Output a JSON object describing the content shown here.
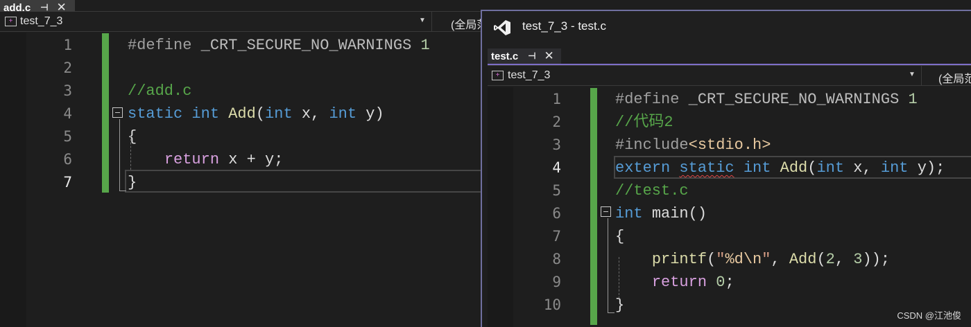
{
  "left_window": {
    "tab": {
      "label": "add.c",
      "pin_icon": "pin-icon",
      "close_icon": "close-icon"
    },
    "navbar": {
      "project": "test_7_3",
      "scope": "(全局范"
    },
    "lines": [
      {
        "num": "1",
        "tokens": [
          [
            "pp",
            "#define "
          ],
          [
            "macro",
            "_CRT_SECURE_NO_WARNINGS "
          ],
          [
            "num",
            "1"
          ]
        ]
      },
      {
        "num": "2",
        "tokens": []
      },
      {
        "num": "3",
        "tokens": [
          [
            "comment",
            "//add.c"
          ]
        ]
      },
      {
        "num": "4",
        "tokens": [
          [
            "kw",
            "static "
          ],
          [
            "kw",
            "int "
          ],
          [
            "fn",
            "Add"
          ],
          [
            "plain",
            "("
          ],
          [
            "kw",
            "int "
          ],
          [
            "plain",
            "x, "
          ],
          [
            "kw",
            "int "
          ],
          [
            "plain",
            "y)"
          ]
        ]
      },
      {
        "num": "5",
        "tokens": [
          [
            "plain",
            "{"
          ]
        ]
      },
      {
        "num": "6",
        "tokens": [
          [
            "plain",
            "    "
          ],
          [
            "ctrl",
            "return "
          ],
          [
            "plain",
            "x + y;"
          ]
        ]
      },
      {
        "num": "7",
        "tokens": [
          [
            "plain",
            "}"
          ]
        ]
      }
    ],
    "active_line": "7"
  },
  "right_window": {
    "title": "test_7_3 - test.c",
    "tab": {
      "label": "test.c",
      "pin_icon": "pin-icon",
      "close_icon": "close-icon"
    },
    "navbar": {
      "project": "test_7_3",
      "scope": "(全局范"
    },
    "lines": [
      {
        "num": "1",
        "tokens": [
          [
            "pp",
            "#define "
          ],
          [
            "macro",
            "_CRT_SECURE_NO_WARNINGS "
          ],
          [
            "num",
            "1"
          ]
        ]
      },
      {
        "num": "2",
        "tokens": [
          [
            "comment",
            "//代码2"
          ]
        ]
      },
      {
        "num": "3",
        "tokens": [
          [
            "pp",
            "#include"
          ],
          [
            "hdr",
            "<stdio.h>"
          ]
        ]
      },
      {
        "num": "4",
        "tokens": [
          [
            "kw",
            "extern "
          ],
          [
            "kw-sq",
            "static"
          ],
          [
            "plain",
            " "
          ],
          [
            "kw",
            "int "
          ],
          [
            "fn",
            "Add"
          ],
          [
            "plain",
            "("
          ],
          [
            "kw",
            "int "
          ],
          [
            "plain",
            "x, "
          ],
          [
            "kw",
            "int "
          ],
          [
            "plain",
            "y);"
          ]
        ]
      },
      {
        "num": "5",
        "tokens": [
          [
            "comment",
            "//test.c"
          ]
        ]
      },
      {
        "num": "6",
        "tokens": [
          [
            "kw",
            "int "
          ],
          [
            "plain",
            "main()"
          ]
        ]
      },
      {
        "num": "7",
        "tokens": [
          [
            "plain",
            "{"
          ]
        ]
      },
      {
        "num": "8",
        "tokens": [
          [
            "plain",
            "    "
          ],
          [
            "fn",
            "printf"
          ],
          [
            "plain",
            "("
          ],
          [
            "str",
            "\""
          ],
          [
            "esc",
            "%d\\n"
          ],
          [
            "str",
            "\""
          ],
          [
            "plain",
            ", "
          ],
          [
            "fn",
            "Add"
          ],
          [
            "plain",
            "("
          ],
          [
            "num",
            "2"
          ],
          [
            "plain",
            ", "
          ],
          [
            "num",
            "3"
          ],
          [
            "plain",
            "));"
          ]
        ]
      },
      {
        "num": "9",
        "tokens": [
          [
            "plain",
            "    "
          ],
          [
            "ctrl",
            "return "
          ],
          [
            "num",
            "0"
          ],
          [
            "plain",
            ";"
          ]
        ]
      },
      {
        "num": "10",
        "tokens": [
          [
            "plain",
            "}"
          ]
        ]
      }
    ],
    "active_line": "4"
  },
  "watermark": "CSDN @江池俊",
  "colors": {
    "keyword": "#569cd6",
    "function": "#dcdcaa",
    "comment": "#57a64a",
    "control": "#d8a0df",
    "number": "#b5cea8",
    "change_bar": "#57a64a",
    "tab_accent": "#7d6ec8"
  }
}
